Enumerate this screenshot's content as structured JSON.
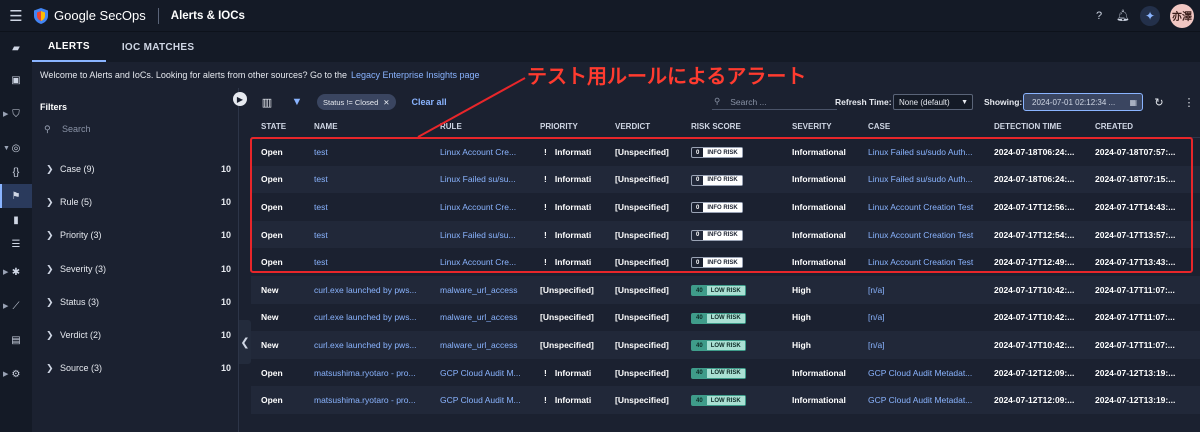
{
  "header": {
    "brand": "Google SecOps",
    "app_title": "Alerts & IOCs",
    "avatar_initials": "亦澤"
  },
  "tabs": [
    {
      "label": "ALERTS",
      "active": true
    },
    {
      "label": "IOC MATCHES",
      "active": false
    }
  ],
  "welcome": {
    "text": "Welcome to Alerts and IoCs. Looking for alerts from other sources? Go to the",
    "link": "Legacy Enterprise Insights page"
  },
  "filters": {
    "title": "Filters",
    "search_placeholder": "Search",
    "facets": [
      {
        "label": "Case (9)",
        "count": "10"
      },
      {
        "label": "Rule (5)",
        "count": "10"
      },
      {
        "label": "Priority (3)",
        "count": "10"
      },
      {
        "label": "Severity (3)",
        "count": "10"
      },
      {
        "label": "Status (3)",
        "count": "10"
      },
      {
        "label": "Verdict (2)",
        "count": "10"
      },
      {
        "label": "Source (3)",
        "count": "10"
      }
    ]
  },
  "toolbar": {
    "status_chip": "Status != Closed",
    "clear_all": "Clear all",
    "search_placeholder": "Search ...",
    "refresh_label": "Refresh Time:",
    "refresh_value": "None (default)",
    "showing_label": "Showing:",
    "showing_value": "2024-07-01 02:12:34 ..."
  },
  "table": {
    "columns": [
      "STATE",
      "NAME",
      "RULE",
      "PRIORITY",
      "VERDICT",
      "RISK SCORE",
      "SEVERITY",
      "CASE",
      "DETECTION TIME",
      "CREATED"
    ],
    "rows": [
      {
        "state": "Open",
        "name": "test",
        "rule": "Linux Account Cre...",
        "priority_mark": "!",
        "priority": "Informati",
        "verdict": "[Unspecified]",
        "risk_score": "0",
        "risk_label": "INFO RISK",
        "risk_level": "info",
        "severity": "Informational",
        "case": "Linux Failed su/sudo Auth...",
        "detection_time": "2024-07-18T06:24:...",
        "created": "2024-07-18T07:57:..."
      },
      {
        "state": "Open",
        "name": "test",
        "rule": "Linux Failed su/su...",
        "priority_mark": "!",
        "priority": "Informati",
        "verdict": "[Unspecified]",
        "risk_score": "0",
        "risk_label": "INFO RISK",
        "risk_level": "info",
        "severity": "Informational",
        "case": "Linux Failed su/sudo Auth...",
        "detection_time": "2024-07-18T06:24:...",
        "created": "2024-07-18T07:15:..."
      },
      {
        "state": "Open",
        "name": "test",
        "rule": "Linux Account Cre...",
        "priority_mark": "!",
        "priority": "Informati",
        "verdict": "[Unspecified]",
        "risk_score": "0",
        "risk_label": "INFO RISK",
        "risk_level": "info",
        "severity": "Informational",
        "case": "Linux Account Creation Test",
        "detection_time": "2024-07-17T12:56:...",
        "created": "2024-07-17T14:43:..."
      },
      {
        "state": "Open",
        "name": "test",
        "rule": "Linux Failed su/su...",
        "priority_mark": "!",
        "priority": "Informati",
        "verdict": "[Unspecified]",
        "risk_score": "0",
        "risk_label": "INFO RISK",
        "risk_level": "info",
        "severity": "Informational",
        "case": "Linux Account Creation Test",
        "detection_time": "2024-07-17T12:54:...",
        "created": "2024-07-17T13:57:..."
      },
      {
        "state": "Open",
        "name": "test",
        "rule": "Linux Account Cre...",
        "priority_mark": "!",
        "priority": "Informati",
        "verdict": "[Unspecified]",
        "risk_score": "0",
        "risk_label": "INFO RISK",
        "risk_level": "info",
        "severity": "Informational",
        "case": "Linux Account Creation Test",
        "detection_time": "2024-07-17T12:49:...",
        "created": "2024-07-17T13:43:..."
      },
      {
        "state": "New",
        "name": "curl.exe launched by pws...",
        "rule": "malware_url_access",
        "priority_mark": "",
        "priority": "[Unspecified]",
        "verdict": "[Unspecified]",
        "risk_score": "40",
        "risk_label": "LOW RISK",
        "risk_level": "low",
        "severity": "High",
        "case": "[n/a]",
        "detection_time": "2024-07-17T10:42:...",
        "created": "2024-07-17T11:07:..."
      },
      {
        "state": "New",
        "name": "curl.exe launched by pws...",
        "rule": "malware_url_access",
        "priority_mark": "",
        "priority": "[Unspecified]",
        "verdict": "[Unspecified]",
        "risk_score": "40",
        "risk_label": "LOW RISK",
        "risk_level": "low",
        "severity": "High",
        "case": "[n/a]",
        "detection_time": "2024-07-17T10:42:...",
        "created": "2024-07-17T11:07:..."
      },
      {
        "state": "New",
        "name": "curl.exe launched by pws...",
        "rule": "malware_url_access",
        "priority_mark": "",
        "priority": "[Unspecified]",
        "verdict": "[Unspecified]",
        "risk_score": "40",
        "risk_label": "LOW RISK",
        "risk_level": "low",
        "severity": "High",
        "case": "[n/a]",
        "detection_time": "2024-07-17T10:42:...",
        "created": "2024-07-17T11:07:..."
      },
      {
        "state": "Open",
        "name": "matsushima.ryotaro - pro...",
        "rule": "GCP Cloud Audit M...",
        "priority_mark": "!",
        "priority": "Informati",
        "verdict": "[Unspecified]",
        "risk_score": "40",
        "risk_label": "LOW RISK",
        "risk_level": "low",
        "severity": "Informational",
        "case": "GCP Cloud Audit Metadat...",
        "detection_time": "2024-07-12T12:09:...",
        "created": "2024-07-12T13:19:..."
      },
      {
        "state": "Open",
        "name": "matsushima.ryotaro - pro...",
        "rule": "GCP Cloud Audit M...",
        "priority_mark": "!",
        "priority": "Informati",
        "verdict": "[Unspecified]",
        "risk_score": "40",
        "risk_label": "LOW RISK",
        "risk_level": "low",
        "severity": "Informational",
        "case": "GCP Cloud Audit Metadat...",
        "detection_time": "2024-07-12T12:09:...",
        "created": "2024-07-12T13:19:..."
      }
    ]
  },
  "annotation": {
    "text": "テスト用ルールによるアラート",
    "color": "#ff3b2f"
  },
  "colors": {
    "accent": "#8ab4ff",
    "background": "#1b2130",
    "annotation": "#e8262a"
  }
}
